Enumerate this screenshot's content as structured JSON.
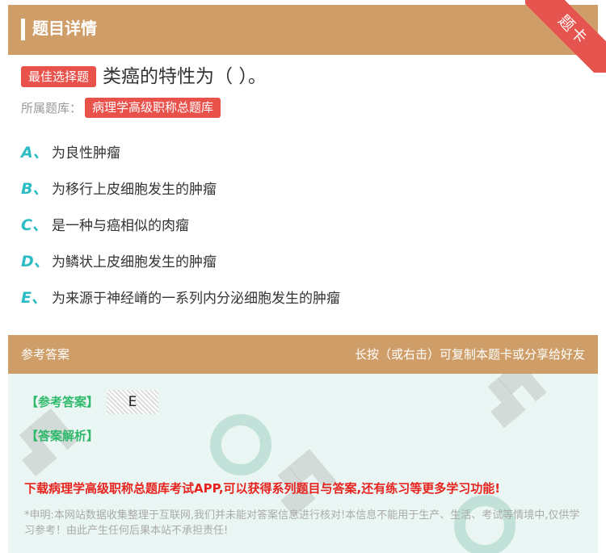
{
  "header": {
    "title": "题目详情",
    "ribbon": "题卡"
  },
  "question": {
    "type_badge": "最佳选择题",
    "text": "类癌的特性为（ ）。",
    "bank_label": "所属题库：",
    "bank_name": "病理学高级职称总题库"
  },
  "options": [
    {
      "letter": "A、",
      "text": "为良性肿瘤"
    },
    {
      "letter": "B、",
      "text": "为移行上皮细胞发生的肿瘤"
    },
    {
      "letter": "C、",
      "text": "是一种与癌相似的肉瘤"
    },
    {
      "letter": "D、",
      "text": "为鳞状上皮细胞发生的肿瘤"
    },
    {
      "letter": "E、",
      "text": "为来源于神经嵴的一系列内分泌细胞发生的肿瘤"
    }
  ],
  "answer_section": {
    "header_left": "参考答案",
    "header_right": "长按（或右击）可复制本题卡或分享给好友",
    "answer_label": "【参考答案】",
    "answer_value": "E",
    "analysis_label": "【答案解析】",
    "download_text": "下载病理学高级职称总题库考试APP,可以获得系列题目与答案,还有练习等更多学习功能!",
    "disclaimer": "*申明:本网站数据收集整理于互联网,我们并未能对答案信息进行核对!本信息不能用于生产、生活、考试等情境中,仅供学习参考！由此产生任何后果本站不承担责任!"
  },
  "colors": {
    "accent": "#cf9d68",
    "badge": "#e9514b",
    "option_letter": "#2bbcc4",
    "answer_label": "#2fb96b",
    "download": "#e8231f"
  }
}
